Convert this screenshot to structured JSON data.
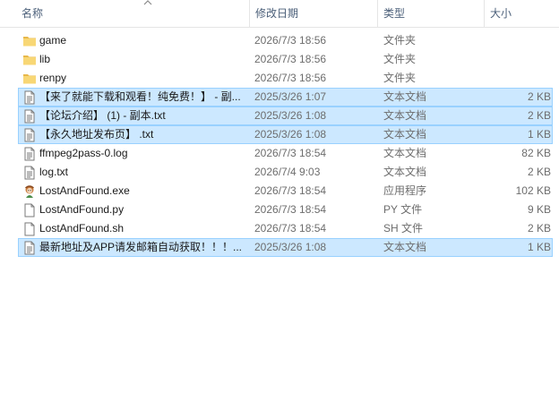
{
  "columns": {
    "name": "名称",
    "date": "修改日期",
    "type": "类型",
    "size": "大小"
  },
  "files": [
    {
      "icon": "folder-icon",
      "name": "game",
      "date": "2026/7/3 18:56",
      "type": "文件夹",
      "size": "",
      "selected": false
    },
    {
      "icon": "folder-icon",
      "name": "lib",
      "date": "2026/7/3 18:56",
      "type": "文件夹",
      "size": "",
      "selected": false
    },
    {
      "icon": "folder-icon",
      "name": "renpy",
      "date": "2026/7/3 18:56",
      "type": "文件夹",
      "size": "",
      "selected": false
    },
    {
      "icon": "text-file-icon",
      "name": "【来了就能下载和观看！纯免费！】 - 副...",
      "date": "2025/3/26 1:07",
      "type": "文本文档",
      "size": "2 KB",
      "selected": true
    },
    {
      "icon": "text-file-icon",
      "name": "【论坛介绍】 (1) - 副本.txt",
      "date": "2025/3/26 1:08",
      "type": "文本文档",
      "size": "2 KB",
      "selected": true
    },
    {
      "icon": "text-file-icon",
      "name": "【永久地址发布页】 .txt",
      "date": "2025/3/26 1:08",
      "type": "文本文档",
      "size": "1 KB",
      "selected": true
    },
    {
      "icon": "text-file-icon",
      "name": "ffmpeg2pass-0.log",
      "date": "2026/7/3 18:54",
      "type": "文本文档",
      "size": "82 KB",
      "selected": false
    },
    {
      "icon": "text-file-icon",
      "name": "log.txt",
      "date": "2026/7/4 9:03",
      "type": "文本文档",
      "size": "2 KB",
      "selected": false
    },
    {
      "icon": "app-icon",
      "name": "LostAndFound.exe",
      "date": "2026/7/3 18:54",
      "type": "应用程序",
      "size": "102 KB",
      "selected": false
    },
    {
      "icon": "blank-file-icon",
      "name": "LostAndFound.py",
      "date": "2026/7/3 18:54",
      "type": "PY 文件",
      "size": "9 KB",
      "selected": false
    },
    {
      "icon": "blank-file-icon",
      "name": "LostAndFound.sh",
      "date": "2026/7/3 18:54",
      "type": "SH 文件",
      "size": "2 KB",
      "selected": false
    },
    {
      "icon": "text-file-icon",
      "name": "最新地址及APP请发邮箱自动获取！！！...",
      "date": "2025/3/26 1:08",
      "type": "文本文档",
      "size": "1 KB",
      "selected": true
    }
  ],
  "colors": {
    "selection_fill": "#cce8ff",
    "selection_border": "#99d1ff",
    "folder": "#f8d775",
    "header_text": "#4c607a"
  }
}
